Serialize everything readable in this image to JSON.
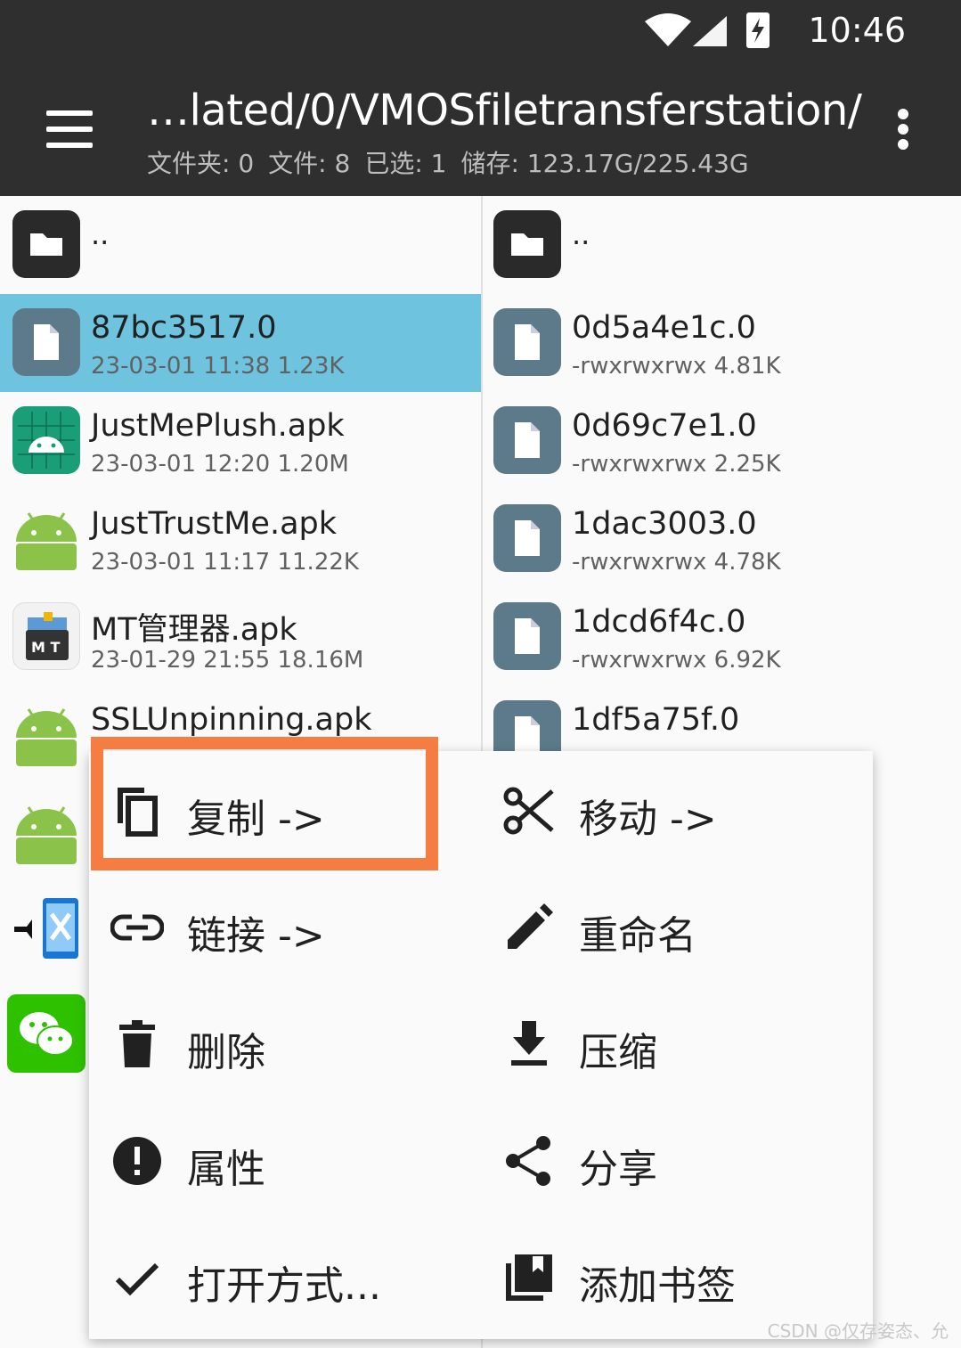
{
  "status_bar": {
    "time": "10:46"
  },
  "app_bar": {
    "path": "…lated/0/VMOSfiletransferstation/",
    "info": {
      "folders": "文件夹: 0",
      "files": "文件: 8",
      "selected": "已选: 1",
      "storage": "储存: 123.17G/225.43G"
    }
  },
  "left_pane": {
    "parent": "..",
    "items": [
      {
        "name": "87bc3517.0",
        "meta": "23-03-01 11:38  1.23K",
        "selected": true
      },
      {
        "name": "JustMePlush.apk",
        "meta": "23-03-01 12:20  1.20M"
      },
      {
        "name": "JustTrustMe.apk",
        "meta": "23-03-01 11:17  11.22K"
      },
      {
        "name": "MT管理器.apk",
        "meta": "23-01-29 21:55  18.16M"
      },
      {
        "name": "SSLUnpinning.apk",
        "meta": ""
      }
    ]
  },
  "right_pane": {
    "parent": "..",
    "items": [
      {
        "name": "0d5a4e1c.0",
        "meta": "-rwxrwxrwx  4.81K"
      },
      {
        "name": "0d69c7e1.0",
        "meta": "-rwxrwxrwx  2.25K"
      },
      {
        "name": "1dac3003.0",
        "meta": "-rwxrwxrwx  4.78K"
      },
      {
        "name": "1dcd6f4c.0",
        "meta": "-rwxrwxrwx  6.92K"
      },
      {
        "name": "1df5a75f.0",
        "meta": ""
      }
    ]
  },
  "context_menu": {
    "copy": "复制 ->",
    "move": "移动 ->",
    "link": "链接 ->",
    "rename": "重命名",
    "delete": "删除",
    "compress": "压缩",
    "properties": "属性",
    "share": "分享",
    "open_with": "打开方式...",
    "bookmark": "添加书签"
  },
  "colors": {
    "appbar": "#2f2f2f",
    "selected_row": "#6ec3df",
    "highlight": "#f57d42"
  },
  "watermark": "CSDN @仅存姿态、允"
}
